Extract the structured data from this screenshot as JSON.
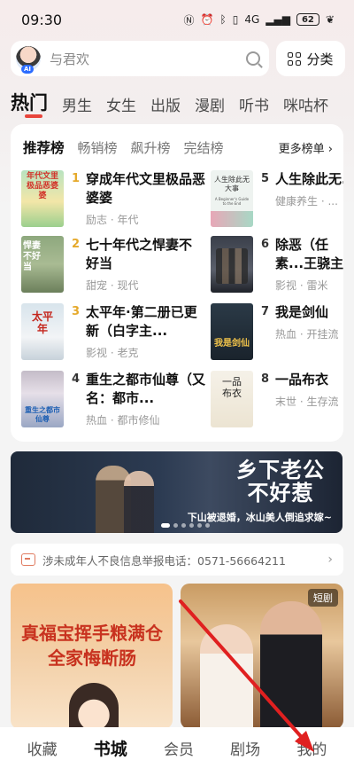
{
  "status": {
    "time": "09:30",
    "signal": "4G",
    "battery": "62"
  },
  "search": {
    "placeholder": "与君欢",
    "avatar_badge": "AI",
    "category_label": "分类"
  },
  "channels": [
    "热门",
    "男生",
    "女生",
    "出版",
    "漫剧",
    "听书",
    "咪咕杯"
  ],
  "rank": {
    "tabs": [
      "推荐榜",
      "畅销榜",
      "飙升榜",
      "完结榜"
    ],
    "more": "更多榜单",
    "books": [
      {
        "num": "1",
        "title": "穿成年代文里极品恶婆婆",
        "tags": "励志 · 年代",
        "num_color": "#e5a92b"
      },
      {
        "num": "2",
        "title": "七十年代之悍妻不好当",
        "tags": "甜宠 · 现代",
        "num_color": "#e5a92b"
      },
      {
        "num": "3",
        "title": "太平年·第二册已更新（白字主...",
        "tags": "影视 · 老克",
        "num_color": "#e5a92b"
      },
      {
        "num": "4",
        "title": "重生之都市仙尊（又名：都市...",
        "tags": "热血 · 都市修仙",
        "num_color": "#333333"
      },
      {
        "num": "5",
        "title": "人生除此无...",
        "tags": "健康养生 · ...",
        "num_color": "#333333"
      },
      {
        "num": "6",
        "title": "除恶（任素...王骁主演国...",
        "tags": "影视 · 雷米",
        "num_color": "#333333"
      },
      {
        "num": "7",
        "title": "我是剑仙",
        "tags": "热血 · 开挂流",
        "num_color": "#333333"
      },
      {
        "num": "8",
        "title": "一品布衣",
        "tags": "末世 · 生存流",
        "num_color": "#333333"
      }
    ],
    "covers": {
      "1": "年代文里极品恶婆婆",
      "2": "悍妻不好当",
      "3": "太平年",
      "4": "重生之都市仙尊",
      "5": "人生除此无大事",
      "5_sub": "A Beginner's Guide to the End",
      "7": "我是剑仙",
      "8": "一品布衣"
    }
  },
  "banner": {
    "title_line1": "乡下老公",
    "title_line2": "不好惹",
    "subtitle": "下山被退婚，冰山美人倒追求嫁~"
  },
  "notice": {
    "text": "涉未成年人不良信息举报电话：0571-56664211"
  },
  "recommend": {
    "left_title": "真福宝挥手粮满仓全家悔断肠",
    "right_badge": "短剧"
  },
  "bottom_nav": [
    "收藏",
    "书城",
    "会员",
    "剧场",
    "我的"
  ],
  "colors": {
    "accent": "#e8453c",
    "rank_gold": "#e5a92b"
  }
}
